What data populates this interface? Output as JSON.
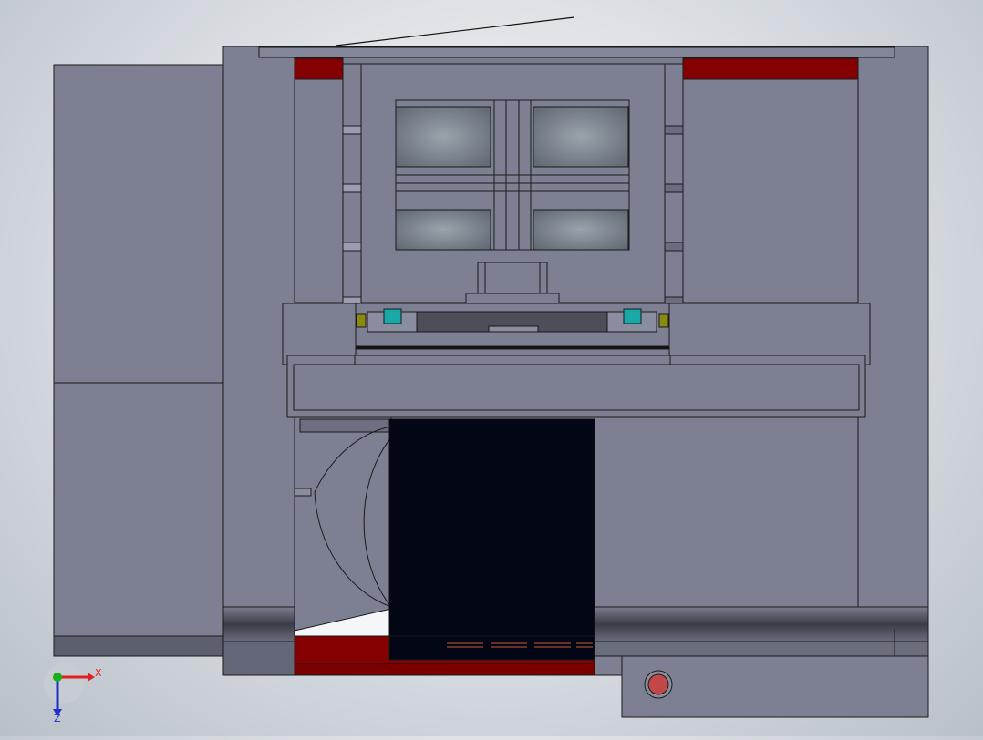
{
  "viewport": {
    "background": "#dfe3e8"
  },
  "model": {
    "colors": {
      "body": "#7d8093",
      "body_dark": "#5f6272",
      "edge": "#1a1a1a",
      "accent_red": "#850000",
      "window_glass": "#7f8a94",
      "black_block": "#030614",
      "teal": "#18a8a8",
      "olive": "#8a8a10",
      "button": "#c24848"
    }
  },
  "triad": {
    "x_label": "X",
    "z_label": "Z",
    "x_color": "#e02020",
    "y_color": "#18b018",
    "z_color": "#2030d0"
  }
}
